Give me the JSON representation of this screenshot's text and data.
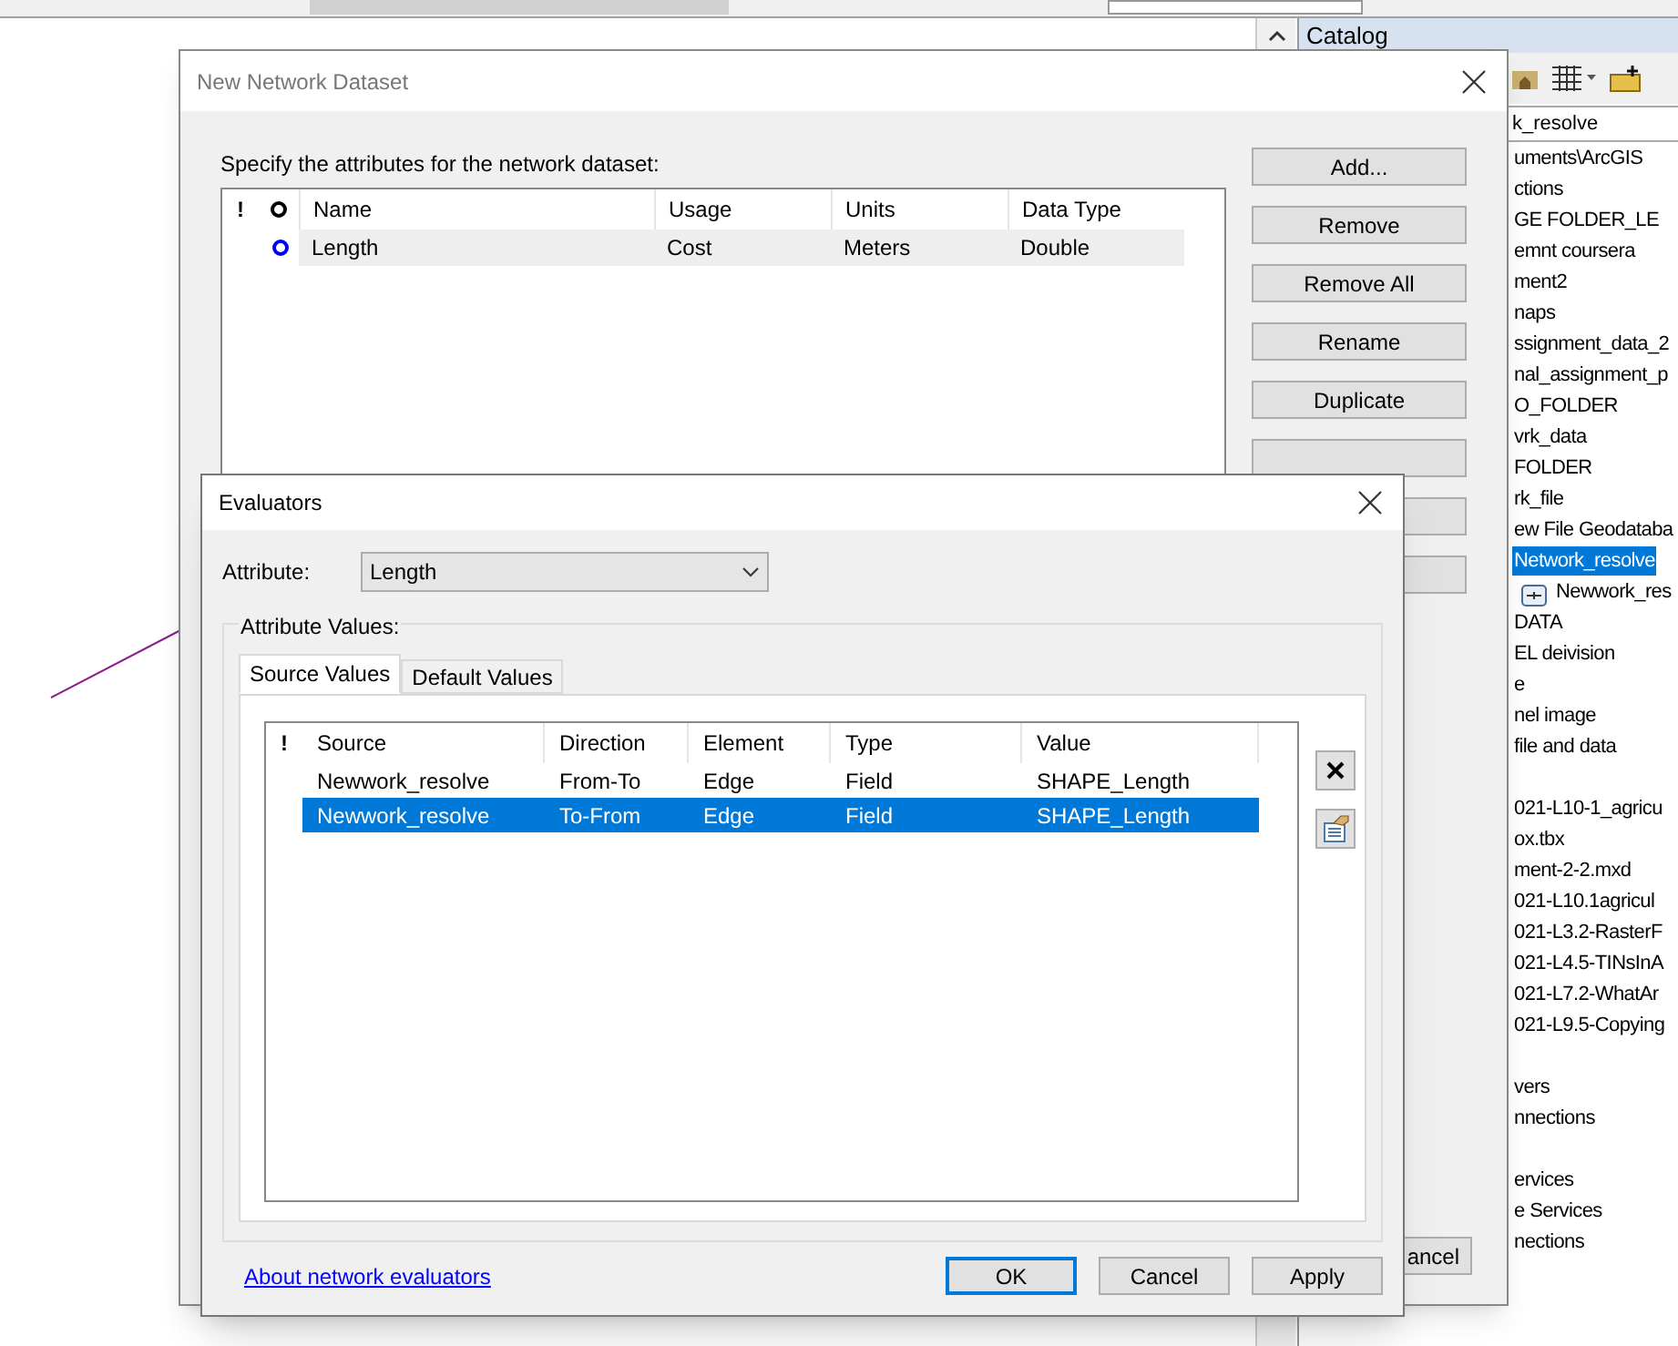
{
  "catalog": {
    "title": "Catalog",
    "location": "k_resolve",
    "items": [
      {
        "label": "uments\\ArcGIS",
        "selected": false
      },
      {
        "label": "ctions",
        "selected": false
      },
      {
        "label": "GE FOLDER_LE",
        "selected": false
      },
      {
        "label": "emnt coursera",
        "selected": false
      },
      {
        "label": "ment2",
        "selected": false
      },
      {
        "label": "naps",
        "selected": false
      },
      {
        "label": "ssignment_data_2",
        "selected": false
      },
      {
        "label": "nal_assignment_p",
        "selected": false
      },
      {
        "label": "O_FOLDER",
        "selected": false
      },
      {
        "label": "vrk_data",
        "selected": false
      },
      {
        "label": "FOLDER",
        "selected": false
      },
      {
        "label": "rk_file",
        "selected": false
      },
      {
        "label": "ew File Geodataba",
        "selected": false
      },
      {
        "label": "Network_resolve",
        "selected": true
      },
      {
        "label": "Newwork_res",
        "selected": false,
        "kind": "dataset"
      },
      {
        "label": "DATA",
        "selected": false
      },
      {
        "label": "EL deivision",
        "selected": false
      },
      {
        "label": "e",
        "selected": false
      },
      {
        "label": "nel image",
        "selected": false
      },
      {
        "label": "file and data",
        "selected": false
      },
      {
        "label": "021-L10-1_agricu",
        "selected": false,
        "gap_before": true
      },
      {
        "label": "ox.tbx",
        "selected": false
      },
      {
        "label": "ment-2-2.mxd",
        "selected": false
      },
      {
        "label": "021-L10.1agricul",
        "selected": false
      },
      {
        "label": "021-L3.2-RasterF",
        "selected": false
      },
      {
        "label": "021-L4.5-TINsInA",
        "selected": false
      },
      {
        "label": "021-L7.2-WhatAr",
        "selected": false
      },
      {
        "label": "021-L9.5-Copying",
        "selected": false
      },
      {
        "label": "vers",
        "selected": false,
        "gap_before": true
      },
      {
        "label": "nnections",
        "selected": false
      },
      {
        "label": "ervices",
        "selected": false,
        "gap_before": true
      },
      {
        "label": "e Services",
        "selected": false
      },
      {
        "label": "nections",
        "selected": false
      }
    ]
  },
  "network_dialog": {
    "title": "New Network Dataset",
    "flag_column": "!",
    "prompt": "Specify the attributes for the network dataset:",
    "columns": [
      "Name",
      "Usage",
      "Units",
      "Data Type"
    ],
    "rows": [
      [
        "Length",
        "Cost",
        "Meters",
        "Double"
      ]
    ],
    "buttons": [
      "Add...",
      "Remove",
      "Remove All",
      "Rename",
      "Duplicate"
    ],
    "cancel_fragment": "ancel"
  },
  "evaluators_dialog": {
    "title": "Evaluators",
    "flag_column": "!",
    "attribute_label": "Attribute:",
    "attribute_value": "Length",
    "group_label": "Attribute Values:",
    "tabs": [
      {
        "label": "Source Values",
        "selected": true
      },
      {
        "label": "Default Values",
        "selected": false
      }
    ],
    "columns": [
      "Source",
      "Direction",
      "Element",
      "Type",
      "Value"
    ],
    "rows": [
      {
        "cells": [
          "Newwork_resolve",
          "From-To",
          "Edge",
          "Field",
          "SHAPE_Length"
        ],
        "selected": false
      },
      {
        "cells": [
          "Newwork_resolve",
          "To-From",
          "Edge",
          "Field",
          "SHAPE_Length"
        ],
        "selected": true
      }
    ],
    "link": "About network evaluators",
    "buttons": [
      {
        "label": "OK",
        "default": true
      },
      {
        "label": "Cancel",
        "default": false
      },
      {
        "label": "Apply",
        "default": false
      }
    ]
  }
}
